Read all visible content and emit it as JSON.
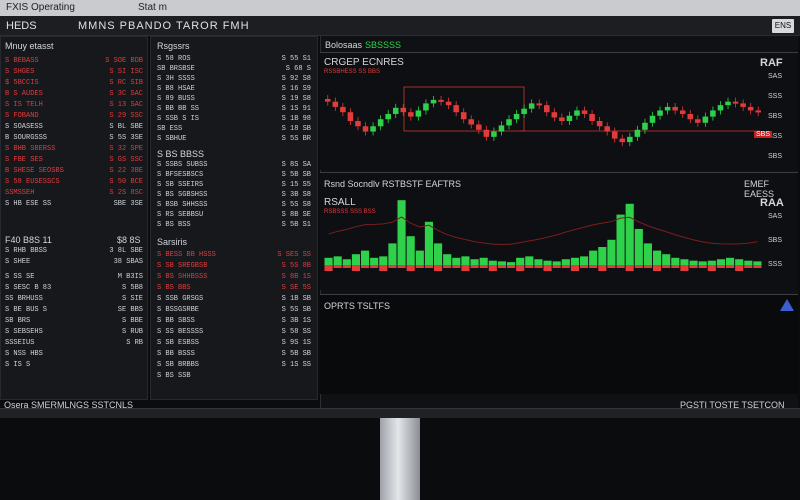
{
  "window": {
    "title_left": "FXIS Operating",
    "title_mid": "Stat m",
    "close_label": "ENS"
  },
  "menu": {
    "app_name": "HEDS",
    "title": "MMNS PBANDO TAROR FMH"
  },
  "left_panel": {
    "title": "Mnuy etasst",
    "rows": [
      {
        "label": "S BEBASS",
        "value": "S SOE BDB",
        "color": "red"
      },
      {
        "label": "S SHGES",
        "value": "S SI ISC",
        "color": "red"
      },
      {
        "label": "$ 5BCCIS",
        "value": "S RC SIB",
        "color": "red"
      },
      {
        "label": "B S AUDES",
        "value": "S 3C SAC",
        "color": "red"
      },
      {
        "label": "S IS TELH",
        "value": "S 13 SAC",
        "color": "red"
      },
      {
        "label": "S FOBAND",
        "value": "S 29 SSC",
        "color": "red"
      },
      {
        "label": "S SOASESS",
        "value": "S BL SBE",
        "color": "wht"
      },
      {
        "label": "B SOURGSSS",
        "value": "S 5S 3SE",
        "color": "wht"
      },
      {
        "label": "S BHB SBERSS",
        "value": "S 32 SPE",
        "color": "red"
      },
      {
        "label": "S FBE SES",
        "value": "S GS SSC",
        "color": "red"
      },
      {
        "label": "B SHESE SEOSBS",
        "value": "S 22 3BE",
        "color": "red"
      },
      {
        "label": "S 58 EUSESSCS",
        "value": "S 50 BCE",
        "color": "red"
      },
      {
        "label": "SSMSSEH",
        "value": "S 2S 8SC",
        "color": "red"
      },
      {
        "label": "S HB ESE SS",
        "value": "SBE 3SE",
        "color": "wht"
      }
    ],
    "mid_title": "F40 B8S 11",
    "mid_value": "$8 8S",
    "mid_rows": [
      {
        "label": "S RHB BBSS",
        "value": "3 8L SBE"
      },
      {
        "label": "S SHEE",
        "value": "38 SBAS"
      }
    ],
    "lower_rows": [
      {
        "label": "S SS SE",
        "value": "M B3IS"
      },
      {
        "label": "S SESC B 83",
        "value": "S 5B8"
      },
      {
        "label": "SS BRHUSS",
        "value": "S SIE"
      },
      {
        "label": "S BE BUS S",
        "value": "SE BBS"
      },
      {
        "label": "SB BRS",
        "value": "S BBE"
      },
      {
        "label": "S SEBSEHS",
        "value": "S RUB"
      },
      {
        "label": "SSSEIUS",
        "value": "S RB"
      },
      {
        "label": "S NSS HBS",
        "value": ""
      },
      {
        "label": "S IS S",
        "value": ""
      }
    ]
  },
  "mid_panel": {
    "title": "Rsgssrs",
    "rows": [
      {
        "label": "S 58 ROS",
        "value": "S 55 S1",
        "color": "wht"
      },
      {
        "label": "SB BRSBSE",
        "value": "S 68 S",
        "color": "wht"
      },
      {
        "label": "S 3H SSSS",
        "value": "S 92 S8",
        "color": "wht"
      },
      {
        "label": "S B8 HSAE",
        "value": "S 16 S9",
        "color": "wht"
      },
      {
        "label": "S 89 BUSS",
        "value": "S 19 S8",
        "color": "wht"
      },
      {
        "label": "S BB BB SS",
        "value": "S 1S 91",
        "color": "wht"
      },
      {
        "label": "S SSB S IS",
        "value": "S 1B 98",
        "color": "wht"
      },
      {
        "label": "SB ESS",
        "value": "S 18 SB",
        "color": "wht"
      },
      {
        "label": "S SBHUE",
        "value": "S 5S BR",
        "color": "wht"
      }
    ],
    "section2_title": "S BS BBSS",
    "section2_rows": [
      {
        "label": "S SSBS SUBSS",
        "value": "S 8S SA"
      },
      {
        "label": "S BFSESBSCS",
        "value": "S 5B SB"
      },
      {
        "label": "S SB SSEIRS",
        "value": "S 15 S5"
      },
      {
        "label": "S BS SGBSHSS",
        "value": "S 3B S8"
      },
      {
        "label": "S BSB SHHSSS",
        "value": "S 5S S8"
      },
      {
        "label": "S RS SEBBSU",
        "value": "S 8B SE"
      },
      {
        "label": "S BS BSS",
        "value": "S 5B S1"
      }
    ],
    "orders_title": "Sarsiris",
    "orders_rows": [
      {
        "label": "S BESS BB HSSS",
        "value": "S SES SS",
        "color": "red"
      },
      {
        "label": "S SB SREGBSB",
        "value": "S 5S 8B",
        "color": "red"
      },
      {
        "label": "S BS SHHBSSS",
        "value": "S 8B 1S",
        "color": "red"
      },
      {
        "label": "S BS BBS",
        "value": "S SE 5S",
        "color": "red"
      },
      {
        "label": "S SSB GRSGS",
        "value": "S 1B SB",
        "color": "wht"
      },
      {
        "label": "S BSSGSRBE",
        "value": "S 5S SB",
        "color": "wht"
      },
      {
        "label": "S BB SBSS",
        "value": "S 3B 1S",
        "color": "wht"
      },
      {
        "label": "S SS BESSSS",
        "value": "S 58 SS",
        "color": "wht"
      },
      {
        "label": "S SB ESBSS",
        "value": "S 9S 1S",
        "color": "wht"
      },
      {
        "label": "S BB BSSS",
        "value": "S 5B SB",
        "color": "wht"
      },
      {
        "label": "S SB BRBBS",
        "value": "S 1S SS",
        "color": "wht"
      },
      {
        "label": "S BS SSB",
        "value": "",
        "color": "wht"
      }
    ]
  },
  "chart": {
    "tab_label": "Bolosaas",
    "tab_value": "SBSSSS",
    "title": "CRGEP ECNRES",
    "subtitle": "RSSBHESS SS BBS",
    "corner_label": "RAF",
    "price_labels": [
      "SAS",
      "SSS",
      "SBS",
      "SSS",
      "SBS"
    ],
    "price_current": "SBS",
    "volume_title": "Rsnd Socndlv  RSTBSTF EAFTRS",
    "volume_right": "EMEF EAESS",
    "volume_label": "RSALL",
    "volume_sub": "RSBSSS SSS BSS",
    "volume_corner": "RAA",
    "volume_axis": [
      "SAS",
      "SBS",
      "SSS"
    ],
    "bottom_title": "OPRTS TSLTFS",
    "candles": [
      [
        0.75,
        0.72
      ],
      [
        0.72,
        0.66
      ],
      [
        0.66,
        0.6
      ],
      [
        0.6,
        0.5
      ],
      [
        0.5,
        0.44
      ],
      [
        0.44,
        0.38
      ],
      [
        0.38,
        0.44
      ],
      [
        0.44,
        0.52
      ],
      [
        0.52,
        0.58
      ],
      [
        0.58,
        0.65
      ],
      [
        0.65,
        0.6
      ],
      [
        0.6,
        0.55
      ],
      [
        0.55,
        0.62
      ],
      [
        0.62,
        0.7
      ],
      [
        0.7,
        0.74
      ],
      [
        0.74,
        0.72
      ],
      [
        0.72,
        0.68
      ],
      [
        0.68,
        0.6
      ],
      [
        0.6,
        0.52
      ],
      [
        0.52,
        0.46
      ],
      [
        0.46,
        0.4
      ],
      [
        0.4,
        0.32
      ],
      [
        0.32,
        0.38
      ],
      [
        0.38,
        0.45
      ],
      [
        0.45,
        0.52
      ],
      [
        0.52,
        0.58
      ],
      [
        0.58,
        0.64
      ],
      [
        0.64,
        0.7
      ],
      [
        0.7,
        0.68
      ],
      [
        0.68,
        0.6
      ],
      [
        0.6,
        0.54
      ],
      [
        0.54,
        0.5
      ],
      [
        0.5,
        0.56
      ],
      [
        0.56,
        0.62
      ],
      [
        0.62,
        0.58
      ],
      [
        0.58,
        0.5
      ],
      [
        0.5,
        0.44
      ],
      [
        0.44,
        0.38
      ],
      [
        0.38,
        0.3
      ],
      [
        0.3,
        0.26
      ],
      [
        0.26,
        0.32
      ],
      [
        0.32,
        0.4
      ],
      [
        0.4,
        0.48
      ],
      [
        0.48,
        0.56
      ],
      [
        0.56,
        0.62
      ],
      [
        0.62,
        0.66
      ],
      [
        0.66,
        0.62
      ],
      [
        0.62,
        0.58
      ],
      [
        0.58,
        0.52
      ],
      [
        0.52,
        0.48
      ],
      [
        0.48,
        0.55
      ],
      [
        0.55,
        0.62
      ],
      [
        0.62,
        0.68
      ],
      [
        0.68,
        0.72
      ],
      [
        0.72,
        0.7
      ],
      [
        0.7,
        0.66
      ],
      [
        0.66,
        0.62
      ],
      [
        0.62,
        0.6
      ]
    ],
    "volumes": [
      0.1,
      0.12,
      0.08,
      0.15,
      0.2,
      0.1,
      0.12,
      0.3,
      0.9,
      0.4,
      0.2,
      0.6,
      0.3,
      0.15,
      0.1,
      0.12,
      0.08,
      0.1,
      0.06,
      0.05,
      0.04,
      0.1,
      0.12,
      0.08,
      0.06,
      0.05,
      0.08,
      0.1,
      0.12,
      0.2,
      0.25,
      0.35,
      0.7,
      0.85,
      0.5,
      0.3,
      0.2,
      0.15,
      0.1,
      0.08,
      0.06,
      0.05,
      0.06,
      0.08,
      0.1,
      0.08,
      0.06,
      0.05
    ],
    "colors": {
      "up": "#2fd14b",
      "down": "#e23b3b",
      "grid": "#2a2d33",
      "line": "#c83a2e"
    }
  },
  "status": {
    "left": "Osera SMERMLNGS SSTCNLS",
    "right": "PGSTI TOSTE TSETCON"
  }
}
